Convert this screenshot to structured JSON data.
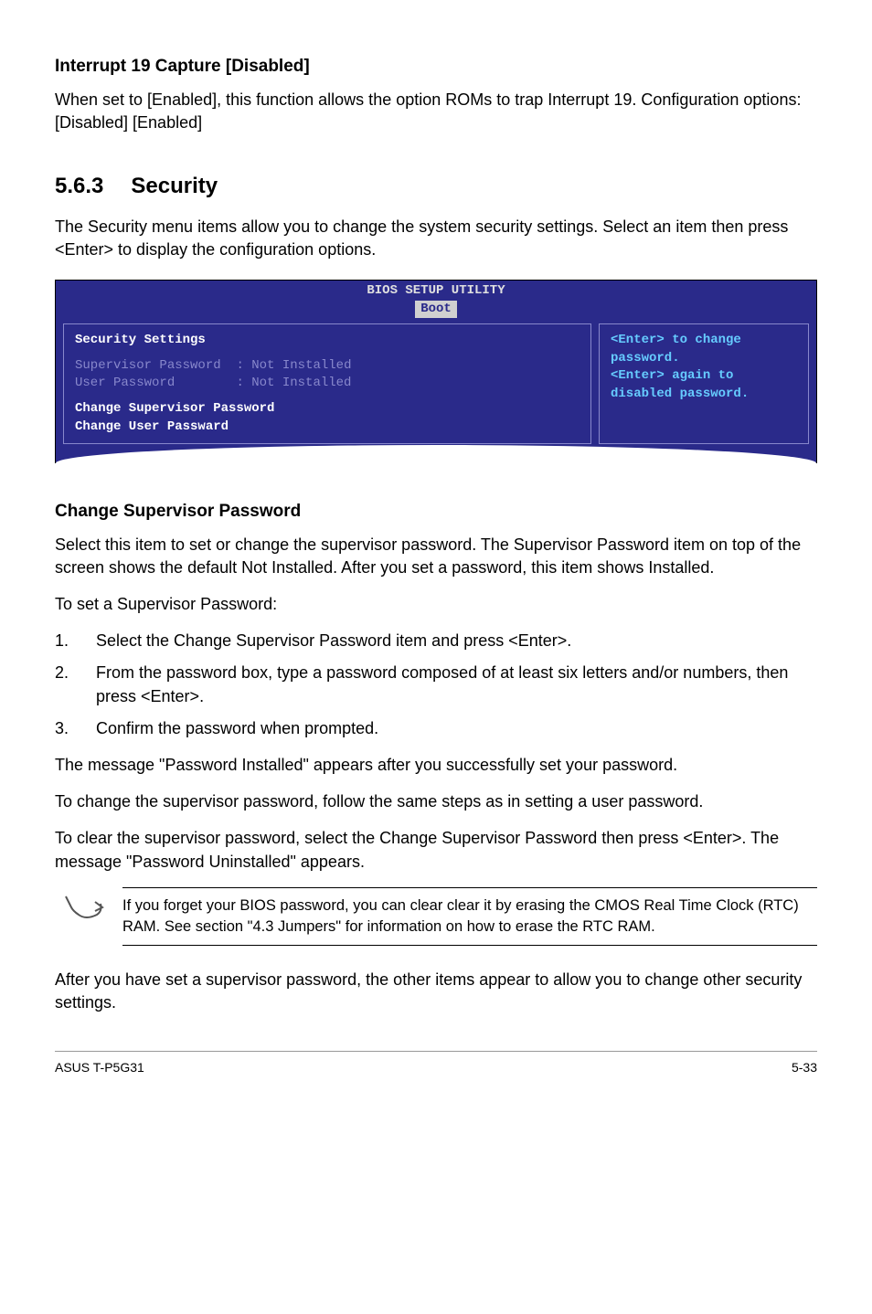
{
  "heading1": "Interrupt 19 Capture [Disabled]",
  "para1": "When set to [Enabled], this function allows the option ROMs to trap Interrupt 19. Configuration options: [Disabled] [Enabled]",
  "section": {
    "num": "5.6.3",
    "title": "Security"
  },
  "para2": "The Security menu items allow you to change the system security settings. Select an item then press <Enter> to display the configuration options.",
  "bios": {
    "title": "BIOS SETUP UTILITY",
    "tab": "Boot",
    "left_heading": "Security Settings",
    "row1_label": "Supervisor Password",
    "row1_value": ": Not Installed",
    "row2_label": "User Password",
    "row2_value": ": Not Installed",
    "highlight1": "Change Supervisor Password",
    "highlight2": "Change User Passward",
    "right_text": "<Enter> to change password.\n<Enter> again to disabled password."
  },
  "heading2": "Change Supervisor Password",
  "para3": "Select this item to set or change the supervisor password. The Supervisor Password item on top of the screen shows the default Not Installed. After you set a password, this item shows Installed.",
  "para4": "To set a Supervisor Password:",
  "steps": [
    "Select the Change Supervisor Password item and press <Enter>.",
    "From the password box, type a password composed of at least six letters and/or numbers, then press <Enter>.",
    "Confirm the password when prompted."
  ],
  "para5": "The message \"Password Installed\" appears after you successfully set your password.",
  "para6": "To change the supervisor password, follow the same steps as in setting a user password.",
  "para7": "To clear the supervisor password, select the Change Supervisor Password then press <Enter>. The message \"Password Uninstalled\" appears.",
  "note": "If you forget your BIOS password, you can clear clear it by erasing the CMOS Real Time Clock (RTC) RAM. See section \"4.3  Jumpers\" for information on how to erase the RTC RAM.",
  "para8": "After you have set a supervisor password, the other items appear to allow you to change other security settings.",
  "footer_left": "ASUS T-P5G31",
  "footer_right": "5-33"
}
